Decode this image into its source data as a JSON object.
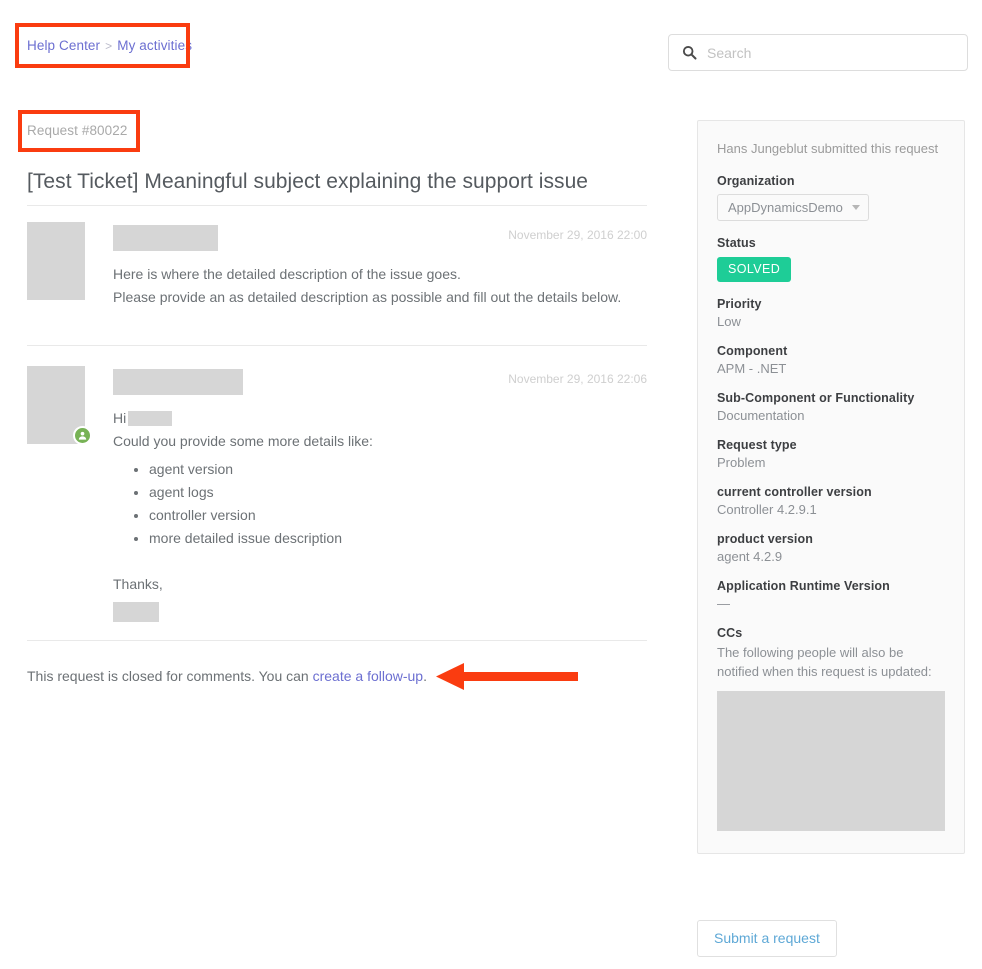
{
  "breadcrumb": {
    "home": "Help Center",
    "separator": ">",
    "current": "My activities"
  },
  "request": {
    "id_label": "Request #80022",
    "title": "[Test Ticket] Meaningful subject explaining the support issue",
    "closed_text_before": "This request is closed for comments. You can ",
    "closed_link": "create a follow-up",
    "closed_text_after": "."
  },
  "comments": [
    {
      "date": "November 29, 2016 22:00",
      "line1": "Here is where the detailed description of the issue goes.",
      "line2": "Please provide an as detailed description as possible and fill out the details below."
    },
    {
      "date": "November 29, 2016 22:06",
      "greeting": "Hi",
      "ask": "Could you provide some more details like:",
      "bullets": [
        "agent version",
        "agent logs",
        "controller version",
        "more detailed issue description"
      ],
      "closing": "Thanks,"
    }
  ],
  "search": {
    "placeholder": "Search",
    "value": "",
    "icon": "search-icon"
  },
  "sidebar": {
    "submitter_line": "Hans Jungeblut submitted this request",
    "organization": {
      "label": "Organization",
      "value": "AppDynamicsDemo"
    },
    "status": {
      "label": "Status",
      "value": "SOLVED",
      "color": "#1ECD97"
    },
    "fields": [
      {
        "label": "Priority",
        "value": "Low"
      },
      {
        "label": "Component",
        "value": "APM - .NET"
      },
      {
        "label": "Sub-Component or Functionality",
        "value": "Documentation"
      },
      {
        "label": "Request type",
        "value": "Problem"
      },
      {
        "label": "current controller version",
        "value": "Controller 4.2.9.1"
      },
      {
        "label": "product version",
        "value": "agent 4.2.9"
      },
      {
        "label": "Application Runtime Version",
        "value": "—"
      }
    ],
    "ccs": {
      "label": "CCs",
      "note": "The following people will also be notified when this request is updated:"
    }
  },
  "actions": {
    "submit_request": "Submit a request"
  },
  "annotation": {
    "color": "#FA3C10"
  }
}
